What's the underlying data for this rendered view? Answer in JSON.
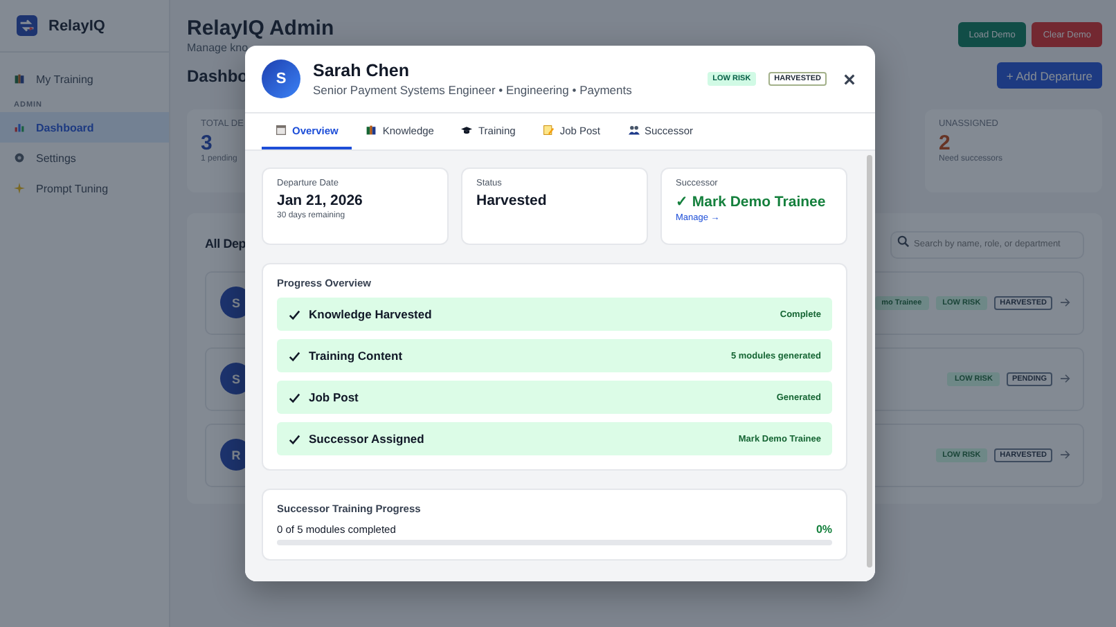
{
  "sidebar": {
    "brand": "RelayIQ",
    "top_items": [
      {
        "label": "My Training",
        "selected": false
      }
    ],
    "section_label": "ADMIN",
    "admin_items": [
      {
        "label": "Dashboard",
        "selected": true
      },
      {
        "label": "Settings",
        "selected": false
      },
      {
        "label": "Prompt Tuning",
        "selected": false
      }
    ]
  },
  "header": {
    "title": "RelayIQ Admin",
    "subtitle": "Manage kno",
    "buttons": [
      {
        "label": "Load Demo",
        "kind": "success"
      },
      {
        "label": "Clear Demo",
        "kind": "danger"
      }
    ]
  },
  "dashboard": {
    "heading": "Dashbo",
    "add_button": "+ Add Departure",
    "stats": [
      {
        "label": "TOTAL DE",
        "value": "3",
        "note": "1 pending"
      },
      {
        "label": "UNASSIGNED",
        "value": "2",
        "note": "Need successors"
      }
    ],
    "list": {
      "title": "All Dep",
      "search": {
        "placeholder": "Search by name, role, or department"
      },
      "rows": [
        {
          "initial": "S",
          "successor": "mo Trainee",
          "risk": "LOW RISK",
          "status": "HARVESTED"
        },
        {
          "initial": "S",
          "risk": "LOW RISK",
          "status": "PENDING"
        },
        {
          "initial": "R",
          "risk": "LOW RISK",
          "status": "HARVESTED"
        }
      ]
    }
  },
  "modal": {
    "initial": "S",
    "name": "Sarah Chen",
    "subtitle": "Senior Payment Systems Engineer • Engineering • Payments",
    "badges": [
      {
        "text": "LOW RISK",
        "kind": "risk"
      },
      {
        "text": "HARVESTED",
        "kind": "status"
      }
    ],
    "tabs": [
      {
        "label": "Overview",
        "selected": true
      },
      {
        "label": "Knowledge",
        "selected": false
      },
      {
        "label": "Training",
        "selected": false
      },
      {
        "label": "Job Post",
        "selected": false
      },
      {
        "label": "Successor",
        "selected": false
      }
    ],
    "cards": [
      {
        "kind": "date",
        "label": "Departure Date",
        "value": "Jan 21, 2026",
        "note": "30 days remaining"
      },
      {
        "kind": "status",
        "label": "Status",
        "value": "Harvested"
      },
      {
        "kind": "successor",
        "label": "Successor",
        "value": "✓ Mark Demo Trainee",
        "link": "Manage →"
      }
    ],
    "progress": {
      "title": "Progress Overview",
      "steps": [
        {
          "label": "Knowledge Harvested",
          "status": "Complete",
          "done": true
        },
        {
          "label": "Training Content",
          "status": "5 modules generated",
          "done": true
        },
        {
          "label": "Job Post",
          "status": "Generated",
          "done": true
        },
        {
          "label": "Successor Assigned",
          "status": "Mark Demo Trainee",
          "done": true
        }
      ]
    },
    "training": {
      "title": "Successor Training Progress",
      "text": "0 of 5 modules completed",
      "percent": "0%",
      "level": 0
    }
  }
}
